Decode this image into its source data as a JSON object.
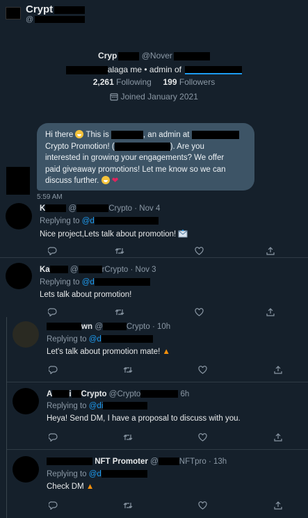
{
  "header": {
    "display_name": "Crypt",
    "handle": "@"
  },
  "profile": {
    "name": "Cryp",
    "handle_fragment": "@Nover",
    "bio_fragment": "alaga me • admin of",
    "following_count": "2,261",
    "following_label": "Following",
    "followers_count": "199",
    "followers_label": "Followers",
    "joined": "Joined January 2021"
  },
  "dm": {
    "line1_a": "Hi there",
    "line1_b": "This is",
    "line1_c": ", an admin at",
    "line2_a": "Crypto Promotion! (",
    "line2_b": "). Are you",
    "line3": "interested in growing your engagements? We offer",
    "line4": "paid giveaway promotions! Let me know so we can",
    "line5": "discuss further.",
    "time": "5:59 AM"
  },
  "tweets": [
    {
      "name": "K",
      "handle": "@",
      "handle_suffix": "Crypto",
      "date": "· Nov 4",
      "replying_to": "Replying to",
      "mention": "@d",
      "text": "Nice project,Lets talk about promotion!"
    },
    {
      "name": "Ka",
      "handle": "@",
      "handle_suffix": "rCrypto",
      "date": "· Nov 3",
      "replying_to": "Replying to",
      "mention": "@d",
      "text": "Lets talk about promotion!"
    },
    {
      "name": "",
      "name_suffix": "wn",
      "handle": "@",
      "handle_suffix": "Crypto",
      "date": "· 10h",
      "replying_to": "Replying to",
      "mention": "@d",
      "text": "Let's talk about promotion mate!"
    },
    {
      "name": "A",
      "name_mid": "i",
      "name_suffix": "Crypto",
      "handle": "@Crypto",
      "date": "6h",
      "replying_to": "Replying to",
      "mention": "@di",
      "text": "Heya! Send DM, I have a proposal to discuss with you."
    },
    {
      "name": "NFT Promoter",
      "handle": "@",
      "handle_suffix": "NFTpro",
      "date": "· 13h",
      "replying_to": "Replying to",
      "mention": "@d",
      "text": "Check DM"
    }
  ],
  "colors": {
    "background": "#15202b",
    "bubble": "#3d5466",
    "link": "#1d9bf0",
    "muted": "#8b98a5"
  },
  "icons": [
    "reply-icon",
    "retweet-icon",
    "like-icon",
    "share-icon",
    "calendar-icon",
    "envelope-icon",
    "fire-icon",
    "heart-icon",
    "grinning-face-icon"
  ]
}
